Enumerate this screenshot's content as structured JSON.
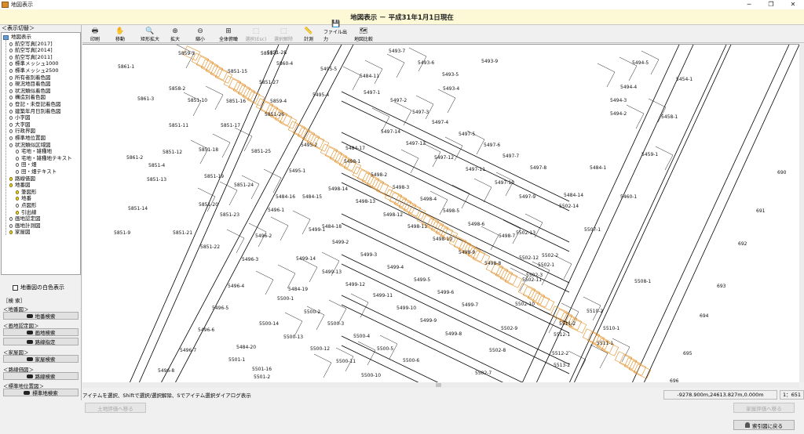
{
  "window": {
    "title": "地図表示",
    "minimize": "─",
    "maximize": "❐",
    "close": "✕"
  },
  "header": {
    "title": "地図表示 － 平成31年1月1日現在"
  },
  "sidebar": {
    "tree_header": "＜表示切替＞",
    "tree": [
      {
        "label": "地図表示",
        "checked": null,
        "level": 0
      },
      {
        "label": "航空写真[2017]",
        "checked": false,
        "level": 1
      },
      {
        "label": "航空写真[2014]",
        "checked": false,
        "level": 1
      },
      {
        "label": "航空写真[2011]",
        "checked": false,
        "level": 1
      },
      {
        "label": "標準メッシュ1000",
        "checked": false,
        "level": 1
      },
      {
        "label": "標準メッシュ2500",
        "checked": false,
        "level": 1
      },
      {
        "label": "所有者別着色図",
        "checked": false,
        "level": 1
      },
      {
        "label": "現況地目着色図",
        "checked": false,
        "level": 1
      },
      {
        "label": "状況類似着色図",
        "checked": false,
        "level": 1
      },
      {
        "label": "構造別着色図",
        "checked": false,
        "level": 1
      },
      {
        "label": "登記・未登記着色図",
        "checked": false,
        "level": 1
      },
      {
        "label": "建築年月日別着色図",
        "checked": false,
        "level": 1
      },
      {
        "label": "小字図",
        "checked": false,
        "level": 1
      },
      {
        "label": "大字図",
        "checked": false,
        "level": 1
      },
      {
        "label": "行政界図",
        "checked": false,
        "level": 1
      },
      {
        "label": "標準地位置図",
        "checked": false,
        "level": 1
      },
      {
        "label": "状況類似区域図",
        "checked": false,
        "level": 1
      },
      {
        "label": "宅地・雑種地",
        "checked": false,
        "level": 2
      },
      {
        "label": "宅地・雑種地テキスト",
        "checked": false,
        "level": 2
      },
      {
        "label": "田・畑",
        "checked": false,
        "level": 2
      },
      {
        "label": "田・畑テキスト",
        "checked": false,
        "level": 2
      },
      {
        "label": "路線価図",
        "checked": true,
        "level": 1
      },
      {
        "label": "地番図",
        "checked": true,
        "level": 1
      },
      {
        "label": "筆図形",
        "checked": true,
        "level": 2
      },
      {
        "label": "地番",
        "checked": true,
        "level": 2
      },
      {
        "label": "点図形",
        "checked": false,
        "level": 2
      },
      {
        "label": "引出線",
        "checked": true,
        "level": 2
      },
      {
        "label": "画地認定図",
        "checked": false,
        "level": 1
      },
      {
        "label": "画地計測図",
        "checked": false,
        "level": 1
      },
      {
        "label": "家屋図",
        "checked": true,
        "level": 1
      }
    ],
    "white_map_option": "地番図の白色表示",
    "search_header": "［検 索］",
    "search_groups": [
      {
        "label": "＜地番図＞",
        "button": "地番検索"
      },
      {
        "label": "＜画地認定図＞",
        "button": "画地検索",
        "button2": "路線指定"
      },
      {
        "label": "＜家屋図＞",
        "button": "家屋検索"
      },
      {
        "label": "＜路線価図＞",
        "button": "路線検索"
      },
      {
        "label": "＜標準地位置図＞",
        "button": "標準地検索"
      }
    ]
  },
  "toolbar": [
    {
      "label": "印刷",
      "icon": "printer-icon",
      "glyph": "🖶",
      "enabled": true
    },
    {
      "label": "移動",
      "icon": "hand-icon",
      "glyph": "✋",
      "enabled": true
    },
    {
      "label": "矩形拡大",
      "icon": "rect-zoom-icon",
      "glyph": "🔍",
      "enabled": true
    },
    {
      "label": "拡大",
      "icon": "zoom-in-icon",
      "glyph": "⊕",
      "enabled": true
    },
    {
      "label": "縮小",
      "icon": "zoom-out-icon",
      "glyph": "⊖",
      "enabled": true
    },
    {
      "label": "全体俯瞰",
      "icon": "overview-icon",
      "glyph": "⊞",
      "enabled": true
    },
    {
      "label": "選択(Esc)",
      "icon": "select-icon",
      "glyph": "⬚",
      "enabled": false
    },
    {
      "label": "選択解除",
      "icon": "deselect-icon",
      "glyph": "⬚",
      "enabled": false
    },
    {
      "label": "計測",
      "icon": "ruler-icon",
      "glyph": "📏",
      "enabled": true
    },
    {
      "label": "ファイル出力",
      "icon": "file-output-icon",
      "glyph": "💾",
      "enabled": true
    },
    {
      "label": "地図比較",
      "icon": "map-compare-icon",
      "glyph": "🗺",
      "enabled": true
    }
  ],
  "status": {
    "message": "アイテムを選択、Shiftで選択/選択解除、Sでアイテム選択ダイアログ表示",
    "coord": "-9278.900m,24613.827m,0.000m",
    "scale": "1：651"
  },
  "bottom": {
    "left_button": "土地評価へ移る",
    "right_button_disabled": "家屋評価へ移る",
    "back_button": "索引図に戻る"
  },
  "map": {
    "parcels": [
      [
        "5861-1",
        45,
        24
      ],
      [
        "5859-3",
        122,
        7
      ],
      [
        "5851-7",
        227,
        7
      ],
      [
        "5851-28",
        235,
        6
      ],
      [
        "5860-4",
        247,
        20
      ],
      [
        "5495-5",
        303,
        27
      ],
      [
        "5493-7",
        390,
        4
      ],
      [
        "5493-6",
        427,
        19
      ],
      [
        "5493-5",
        458,
        34
      ],
      [
        "5493-4",
        459,
        52
      ],
      [
        "5493-9",
        508,
        17
      ],
      [
        "5494-5",
        700,
        19
      ],
      [
        "5494-4",
        685,
        50
      ],
      [
        "5494-3",
        672,
        67
      ],
      [
        "5494-2",
        672,
        84
      ],
      [
        "5454-1",
        756,
        40
      ],
      [
        "5458-1",
        737,
        88
      ],
      [
        "5459-1",
        712,
        136
      ],
      [
        "5460-1",
        685,
        190
      ],
      [
        "5858-2",
        110,
        52
      ],
      [
        "5861-3",
        70,
        65
      ],
      [
        "5851-15",
        185,
        30
      ],
      [
        "5851-27",
        225,
        44
      ],
      [
        "5851-10",
        134,
        67
      ],
      [
        "5851-16",
        183,
        68
      ],
      [
        "5859-4",
        239,
        68
      ],
      [
        "5851-26",
        232,
        85
      ],
      [
        "5495-4",
        293,
        60
      ],
      [
        "5484-11",
        353,
        36
      ],
      [
        "5497-1",
        358,
        57
      ],
      [
        "5497-2",
        392,
        67
      ],
      [
        "5497-3",
        420,
        82
      ],
      [
        "5497-4",
        445,
        95
      ],
      [
        "5497-5",
        479,
        110
      ],
      [
        "5497-6",
        511,
        124
      ],
      [
        "5497-7",
        535,
        138
      ],
      [
        "5497-8",
        570,
        153
      ],
      [
        "5851-11",
        110,
        99
      ],
      [
        "5851-17",
        176,
        99
      ],
      [
        "5495-2",
        278,
        124
      ],
      [
        "5497-13",
        412,
        122
      ],
      [
        "5497-14",
        380,
        107
      ],
      [
        "5497-12",
        448,
        140
      ],
      [
        "5497-11",
        488,
        155
      ],
      [
        "5497-10",
        525,
        172
      ],
      [
        "5497-9",
        556,
        190
      ],
      [
        "5861-2",
        56,
        140
      ],
      [
        "5851-12",
        102,
        133
      ],
      [
        "5851-18",
        148,
        130
      ],
      [
        "5851-25",
        215,
        132
      ],
      [
        "5851-4",
        84,
        150
      ],
      [
        "5495-1",
        263,
        157
      ],
      [
        "5498-1",
        333,
        145
      ],
      [
        "5498-2",
        367,
        162
      ],
      [
        "5498-3",
        395,
        178
      ],
      [
        "5498-4",
        430,
        193
      ],
      [
        "5498-5",
        459,
        208
      ],
      [
        "5498-6",
        491,
        225
      ],
      [
        "5498-7",
        530,
        240
      ],
      [
        "5851-13",
        82,
        168
      ],
      [
        "5851-19",
        155,
        164
      ],
      [
        "5851-24",
        193,
        175
      ],
      [
        "5484-16",
        246,
        190
      ],
      [
        "5498-14",
        313,
        180
      ],
      [
        "5498-13",
        348,
        196
      ],
      [
        "5498-12",
        383,
        213
      ],
      [
        "5498-11",
        414,
        228
      ],
      [
        "5498-10",
        446,
        244
      ],
      [
        "5498-9",
        479,
        261
      ],
      [
        "5498-8",
        512,
        275
      ],
      [
        "5851-14",
        58,
        205
      ],
      [
        "5851-20",
        148,
        200
      ],
      [
        "5851-23",
        175,
        213
      ],
      [
        "5496-1",
        236,
        207
      ],
      [
        "5484-18",
        305,
        228
      ],
      [
        "5851-9",
        40,
        236
      ],
      [
        "5851-21",
        115,
        236
      ],
      [
        "5499-1",
        288,
        232
      ],
      [
        "5496-2",
        220,
        240
      ],
      [
        "5851-22",
        150,
        254
      ],
      [
        "5499-2",
        318,
        248
      ],
      [
        "5499-3",
        354,
        264
      ],
      [
        "5499-4",
        388,
        280
      ],
      [
        "5499-5",
        422,
        296
      ],
      [
        "5499-6",
        452,
        312
      ],
      [
        "5499-7",
        483,
        328
      ],
      [
        "5496-3",
        203,
        270
      ],
      [
        "5499-14",
        272,
        269
      ],
      [
        "5499-13",
        305,
        286
      ],
      [
        "5499-12",
        335,
        302
      ],
      [
        "5499-11",
        370,
        316
      ],
      [
        "5499-10",
        400,
        332
      ],
      [
        "5499-9",
        430,
        348
      ],
      [
        "5499-8",
        462,
        365
      ],
      [
        "5496-4",
        185,
        304
      ],
      [
        "5484-19",
        262,
        308
      ],
      [
        "5500-1",
        248,
        320
      ],
      [
        "5500-2",
        282,
        337
      ],
      [
        "5500-3",
        312,
        352
      ],
      [
        "5500-4",
        345,
        368
      ],
      [
        "5500-5",
        375,
        384
      ],
      [
        "5500-6",
        408,
        399
      ],
      [
        "5496-5",
        165,
        332
      ],
      [
        "5500-14",
        225,
        352
      ],
      [
        "5500-13",
        256,
        369
      ],
      [
        "5500-12",
        290,
        384
      ],
      [
        "5500-11",
        323,
        400
      ],
      [
        "5500-10",
        355,
        418
      ],
      [
        "5496-6",
        147,
        360
      ],
      [
        "5496-7",
        124,
        386
      ],
      [
        "5501-1",
        186,
        398
      ],
      [
        "5484-20",
        196,
        382
      ],
      [
        "5496-8",
        96,
        412
      ],
      [
        "5501-16",
        216,
        410
      ],
      [
        "5501-2",
        218,
        420
      ],
      [
        "5501-3",
        228,
        430
      ],
      [
        "5502-1",
        580,
        277
      ],
      [
        "5502-2",
        585,
        265
      ],
      [
        "5502-3",
        565,
        290
      ],
      [
        "5502-14",
        607,
        202
      ],
      [
        "5502-13",
        552,
        236
      ],
      [
        "5502-12",
        556,
        268
      ],
      [
        "5502-11",
        560,
        296
      ],
      [
        "5502-10",
        551,
        327
      ],
      [
        "5502-9",
        533,
        358
      ],
      [
        "5502-8",
        518,
        386
      ],
      [
        "5502-7",
        500,
        415
      ],
      [
        "5507-1",
        639,
        232
      ],
      [
        "5508-1",
        703,
        298
      ],
      [
        "5510-2",
        642,
        336
      ],
      [
        "5510-1",
        663,
        358
      ],
      [
        "5511-2",
        607,
        352
      ],
      [
        "5512-1",
        600,
        366
      ],
      [
        "5511-1",
        655,
        377
      ],
      [
        "5512-2",
        598,
        390
      ],
      [
        "5513-2",
        600,
        405
      ],
      [
        "690",
        885,
        159
      ],
      [
        "691",
        858,
        208
      ],
      [
        "692",
        835,
        250
      ],
      [
        "693",
        808,
        304
      ],
      [
        "694",
        786,
        342
      ],
      [
        "695",
        765,
        390
      ],
      [
        "696",
        748,
        425
      ],
      [
        "5484-14",
        613,
        188
      ],
      [
        "5484-17",
        335,
        128
      ],
      [
        "5484-15",
        280,
        190
      ],
      [
        "5484-1",
        646,
        153
      ]
    ]
  }
}
